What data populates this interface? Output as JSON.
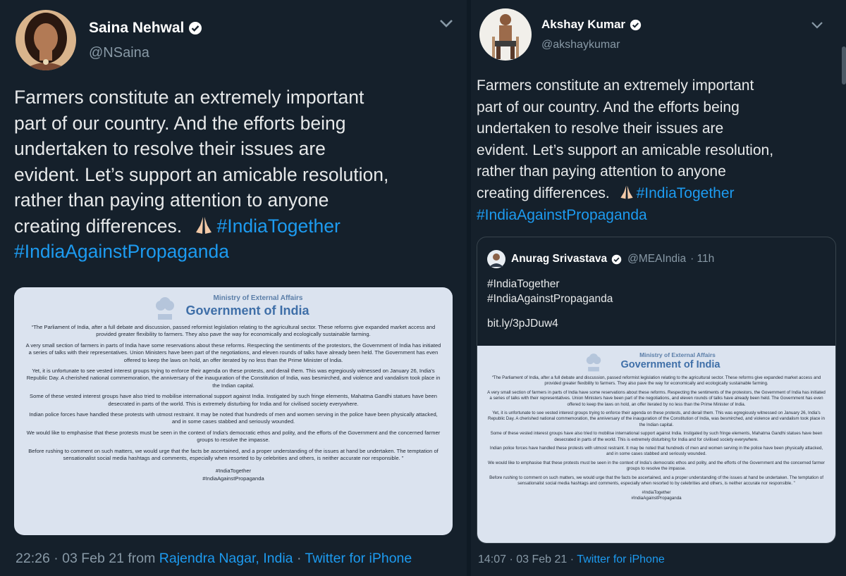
{
  "left_tweet": {
    "display_name": "Saina Nehwal",
    "handle": "@NSaina",
    "text_lines": [
      "Farmers constitute an extremely important",
      "part of our country. And the efforts being",
      "undertaken to resolve their issues are",
      "evident. Let’s support an amicable resolution,",
      "rather than paying attention to anyone",
      "creating differences."
    ],
    "hashtag_1": "#IndiaTogether",
    "hashtag_2": "#IndiaAgainstPropaganda",
    "footer_time": "22:26 · 03 Feb 21 from",
    "footer_location": "Rajendra Nagar, India",
    "footer_sep": "·",
    "footer_source": "Twitter for iPhone"
  },
  "right_tweet": {
    "display_name": "Akshay Kumar",
    "handle": "@akshaykumar",
    "text_lines": [
      "Farmers constitute an extremely important",
      "part of our country. And the efforts being",
      "undertaken to resolve their issues are",
      "evident. Let’s support an amicable resolution,",
      "rather than paying attention to anyone",
      "creating differences."
    ],
    "hashtag_1": "#IndiaTogether",
    "hashtag_2": "#IndiaAgainstPropaganda",
    "quoted": {
      "display_name": "Anurag Srivastava",
      "handle": "@MEAIndia",
      "time": "· 11h",
      "line1": "#IndiaTogether",
      "line2": "#IndiaAgainstPropaganda",
      "link": "bit.ly/3pJDuw4"
    },
    "footer_time": "14:07 · 03 Feb 21 ·",
    "footer_source": "Twitter for iPhone"
  },
  "statement": {
    "ministry": "Ministry of External Affairs",
    "government": "Government of India",
    "paragraphs": [
      "“The Parliament of India, after a full debate and discussion, passed reformist legislation relating to the agricultural sector. These reforms give expanded market access and provided greater flexibility to farmers. They also pave the way for economically and ecologically sustainable farming.",
      "A very small section of farmers in parts of India have some reservations about these reforms. Respecting the sentiments of the protestors, the Government of India has initiated a series of talks with their representatives. Union Ministers have been part of the negotiations, and eleven rounds of talks have already been held. The Government has even offered to keep the laws on hold, an offer iterated by no less than the Prime Minister of India.",
      "Yet, it is unfortunate to see vested interest groups trying to enforce their agenda on these protests, and derail them. This was egregiously witnessed on January 26, India's Republic Day. A cherished national commemoration, the anniversary of the inauguration of the Constitution of India, was besmirched, and violence and vandalism took place in the Indian capital.",
      "Some of these vested interest groups have also tried to mobilise international support against India. Instigated by such fringe elements, Mahatma Gandhi statues have been desecrated in parts of the world. This is extremely disturbing for India and for civilised society everywhere.",
      "Indian police forces have handled these protests with utmost restraint. It may be noted that hundreds of men and women serving in the police have been physically attacked, and in some cases stabbed and seriously wounded.",
      "We would like to emphasise that these protests must be seen in the context of India's democratic ethos and polity, and the efforts of the Government and the concerned farmer groups to resolve the impasse.",
      "Before rushing to comment on such matters, we would urge that the facts be ascertained, and a proper understanding of the issues at hand be undertaken. The temptation of sensationalist social media hashtags and comments, especially when resorted to by celebrities and others, is neither accurate nor responsible. ”"
    ],
    "tag1": "#IndiaTogether",
    "tag2": "#IndiaAgainstPropaganda"
  },
  "colors": {
    "background": "#15202b",
    "link": "#1d9bf0",
    "muted": "#8899a6",
    "doc_bg": "#dbe3ef"
  }
}
